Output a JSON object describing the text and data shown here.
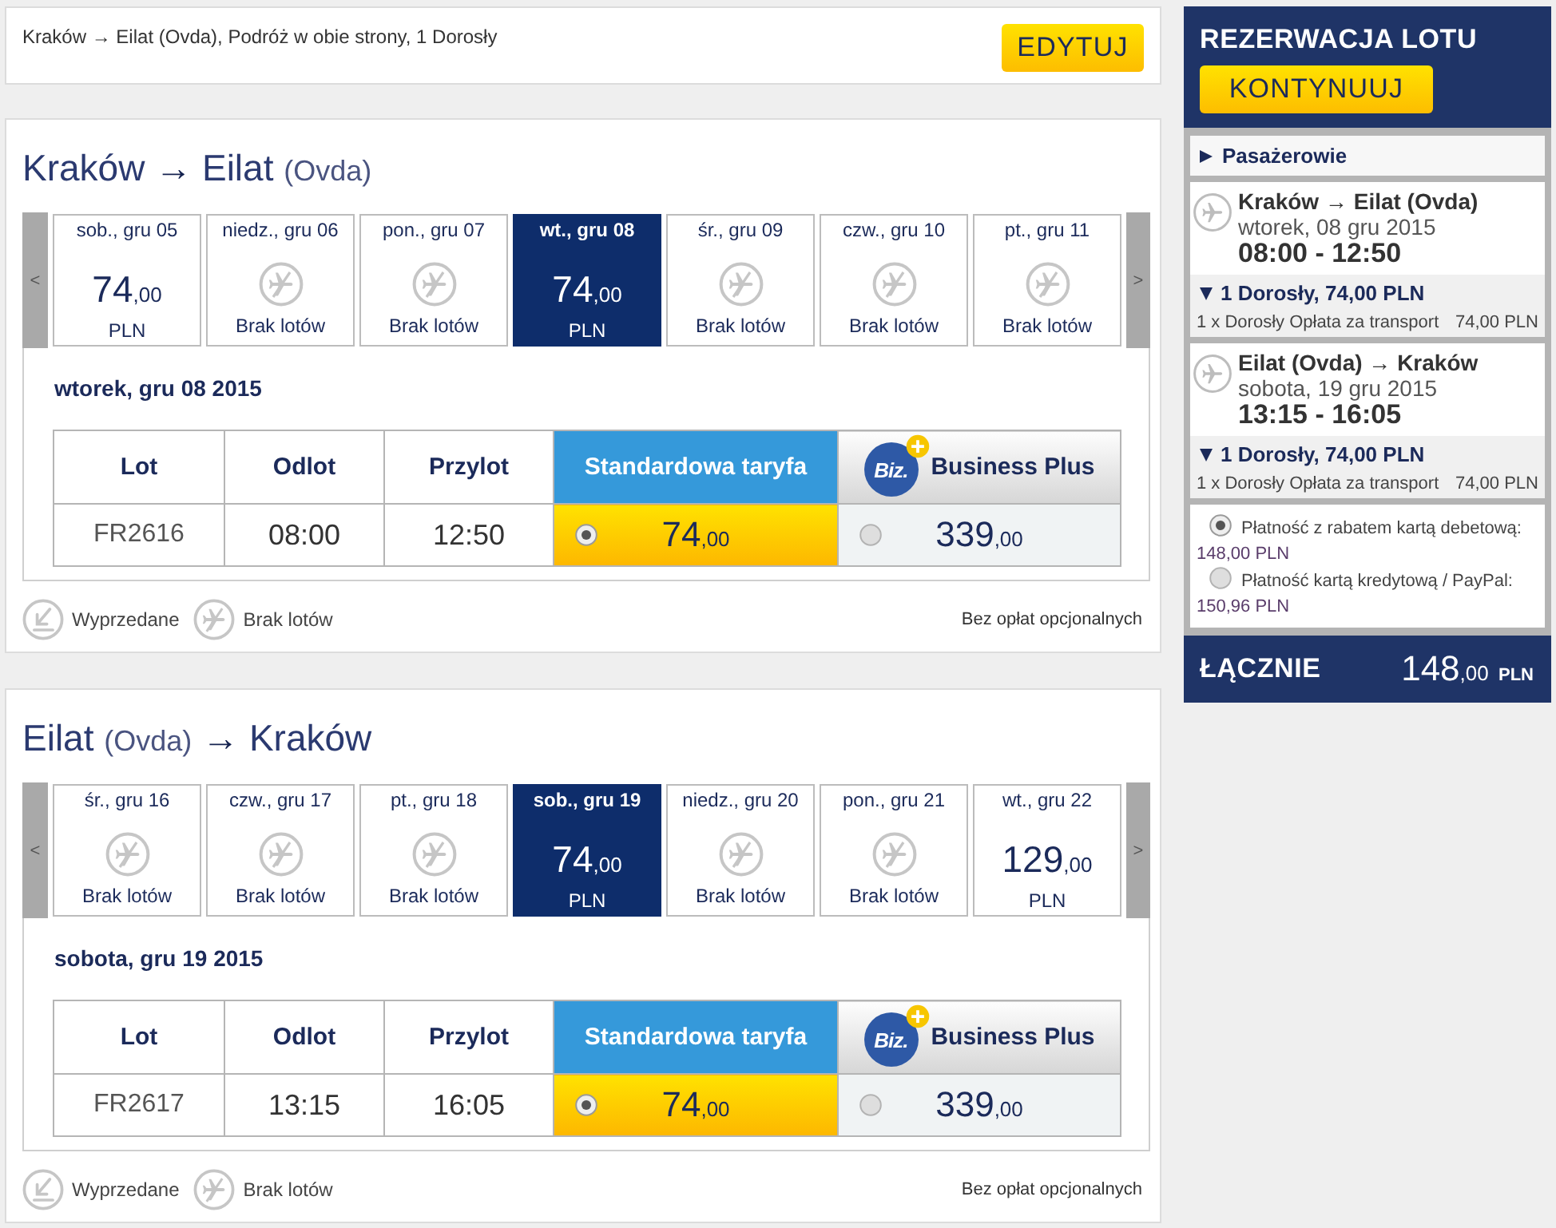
{
  "summary": {
    "text": "Kraków → Eilat (Ovda), Podróż w obie strony, 1 Dorosły",
    "edit_button": "EDYTUJ"
  },
  "journeys": [
    {
      "title": [
        {
          "kind": "city",
          "text": "Kraków"
        },
        {
          "kind": "arrow",
          "text": "→"
        },
        {
          "kind": "city",
          "text": "Eilat"
        },
        {
          "kind": "note",
          "text": "(Ovda)"
        }
      ],
      "prev": "<",
      "next": ">",
      "days": [
        {
          "label": "sob., gru 05",
          "kind": "price",
          "price": "74,00",
          "currency": "PLN",
          "selected": false
        },
        {
          "label": "niedz., gru 06",
          "kind": "none",
          "note": "Brak lotów",
          "selected": false
        },
        {
          "label": "pon., gru 07",
          "kind": "none",
          "note": "Brak lotów",
          "selected": false
        },
        {
          "label": "wt., gru 08",
          "kind": "price",
          "price": "74,00",
          "currency": "PLN",
          "selected": true
        },
        {
          "label": "śr., gru 09",
          "kind": "none",
          "note": "Brak lotów",
          "selected": false
        },
        {
          "label": "czw., gru 10",
          "kind": "none",
          "note": "Brak lotów",
          "selected": false
        },
        {
          "label": "pt., gru 11",
          "kind": "none",
          "note": "Brak lotów",
          "selected": false
        }
      ],
      "date": "wtorek, gru 08 2015",
      "table": {
        "columns": [
          "Lot",
          "Odlot",
          "Przylot"
        ],
        "fares": [
          {
            "kind": "standard",
            "name": "Standardowa taryfa"
          },
          {
            "kind": "business",
            "badge": "Biz.",
            "name": "Business Plus"
          }
        ],
        "rows": [
          {
            "cells": [
              "FR2616",
              "08:00",
              "12:50"
            ],
            "fares": [
              {
                "price": "74,00",
                "selected": true
              },
              {
                "price": "339,00",
                "selected": false
              }
            ]
          }
        ]
      },
      "legend": [
        {
          "kind": "sold_out",
          "label": "Wyprzedane"
        },
        {
          "kind": "no_flights",
          "label": "Brak lotów"
        }
      ],
      "note": "Bez opłat opcjonalnych"
    },
    {
      "title": [
        {
          "kind": "city",
          "text": "Eilat"
        },
        {
          "kind": "note",
          "text": "(Ovda)"
        },
        {
          "kind": "arrow",
          "text": "→"
        },
        {
          "kind": "city",
          "text": "Kraków"
        }
      ],
      "prev": "<",
      "next": ">",
      "days": [
        {
          "label": "śr., gru 16",
          "kind": "none",
          "note": "Brak lotów",
          "selected": false
        },
        {
          "label": "czw., gru 17",
          "kind": "none",
          "note": "Brak lotów",
          "selected": false
        },
        {
          "label": "pt., gru 18",
          "kind": "none",
          "note": "Brak lotów",
          "selected": false
        },
        {
          "label": "sob., gru 19",
          "kind": "price",
          "price": "74,00",
          "currency": "PLN",
          "selected": true
        },
        {
          "label": "niedz., gru 20",
          "kind": "none",
          "note": "Brak lotów",
          "selected": false
        },
        {
          "label": "pon., gru 21",
          "kind": "none",
          "note": "Brak lotów",
          "selected": false
        },
        {
          "label": "wt., gru 22",
          "kind": "price",
          "price": "129,00",
          "currency": "PLN",
          "selected": false
        }
      ],
      "date": "sobota, gru 19 2015",
      "table": {
        "columns": [
          "Lot",
          "Odlot",
          "Przylot"
        ],
        "fares": [
          {
            "kind": "standard",
            "name": "Standardowa taryfa"
          },
          {
            "kind": "business",
            "badge": "Biz.",
            "name": "Business Plus"
          }
        ],
        "rows": [
          {
            "cells": [
              "FR2617",
              "13:15",
              "16:05"
            ],
            "fares": [
              {
                "price": "74,00",
                "selected": true
              },
              {
                "price": "339,00",
                "selected": false
              }
            ]
          }
        ]
      },
      "legend": [
        {
          "kind": "sold_out",
          "label": "Wyprzedane"
        },
        {
          "kind": "no_flights",
          "label": "Brak lotów"
        }
      ],
      "note": "Bez opłat opcjonalnych"
    }
  ],
  "booking": {
    "title": "REZERWACJA LOTU",
    "continue_button": "KONTYNUUJ",
    "passengers": {
      "label": "Pasażerowie",
      "expanded": false
    },
    "legs": [
      {
        "route": "Kraków → Eilat (Ovda)",
        "date": "wtorek, 08 gru 2015",
        "times": "08:00 - 12:50",
        "fare": {
          "label": "1 Dorosły, 74,00 PLN",
          "expanded": true,
          "lines": [
            {
              "label": "1 x Dorosły Opłata za transport",
              "amount": "74,00 PLN"
            }
          ]
        }
      },
      {
        "route": "Eilat (Ovda) → Kraków",
        "date": "sobota, 19 gru 2015",
        "times": "13:15 - 16:05",
        "fare": {
          "label": "1 Dorosły, 74,00 PLN",
          "expanded": true,
          "lines": [
            {
              "label": "1 x Dorosły Opłata za transport",
              "amount": "74,00 PLN"
            }
          ]
        }
      }
    ],
    "payment_options": [
      {
        "label": "Płatność z rabatem kartą debetową:",
        "amount": "148,00 PLN",
        "selected": true
      },
      {
        "label": "Płatność kartą kredytową / PayPal:",
        "amount": "150,96 PLN",
        "selected": false
      }
    ],
    "total": {
      "label": "ŁĄCZNIE",
      "amount": "148,00",
      "currency": "PLN"
    }
  }
}
